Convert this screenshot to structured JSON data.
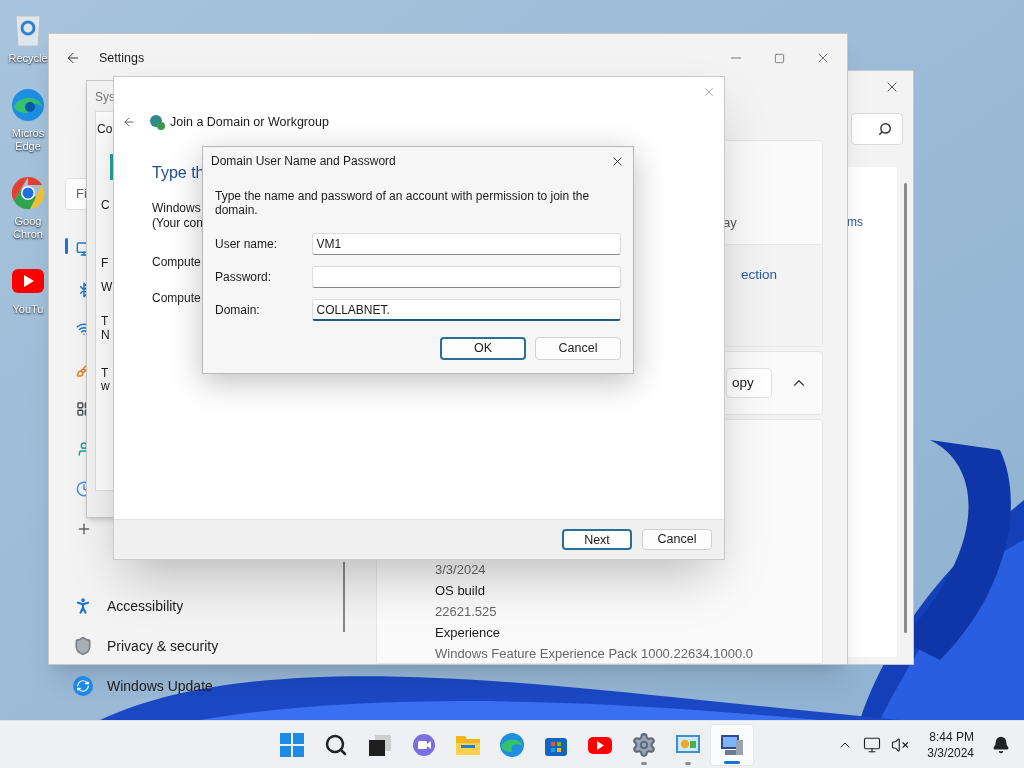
{
  "desktop": {
    "icons": [
      {
        "kind": "recycle",
        "label_lines": [
          "Recycle"
        ]
      },
      {
        "kind": "edge",
        "label_lines": [
          "Micros",
          "Edge"
        ]
      },
      {
        "kind": "chrome",
        "label_lines": [
          "Goog",
          "Chron"
        ]
      },
      {
        "kind": "youtube",
        "label_lines": [
          "YouTu"
        ]
      }
    ]
  },
  "back_window": {
    "link": "ms"
  },
  "settings": {
    "title": "Settings",
    "search": {
      "placeholder": "Fi"
    },
    "sidebar": {
      "items": [
        {
          "kind": "accessibility",
          "label": "Accessibility"
        },
        {
          "kind": "privacy",
          "label": "Privacy & security"
        },
        {
          "kind": "update",
          "label": "Windows Update"
        }
      ]
    },
    "cards": {
      "text": "ay",
      "link": "ection",
      "button": "opy"
    },
    "specs": [
      {
        "kind": "value",
        "text": "3/3/2024"
      },
      {
        "kind": "heading",
        "text": "OS build"
      },
      {
        "kind": "value",
        "text": "22621.525"
      },
      {
        "kind": "heading",
        "text": "Experience"
      },
      {
        "kind": "value",
        "text": "Windows Feature Experience Pack 1000.22634.1000.0"
      }
    ]
  },
  "system_window": {
    "title": "Sys",
    "tab": "Co",
    "fragments": [
      "C",
      "F",
      "W",
      "T",
      "N",
      "T",
      "w"
    ]
  },
  "join_window": {
    "title": "Join a Domain or Workgroup",
    "heading": "Type th",
    "lines": [
      "Windows",
      "(Your con"
    ],
    "labels": [
      "Compute",
      "Compute"
    ],
    "buttons": [
      {
        "label": "Next",
        "default": true
      },
      {
        "label": "Cancel",
        "default": false
      }
    ]
  },
  "dialog": {
    "title": "Domain User Name and Password",
    "text": "Type the name and password of an account with permission to join the domain.",
    "fields": [
      {
        "label": "User name:",
        "value": "VM1",
        "focused": false
      },
      {
        "label": "Password:",
        "focused": false
      },
      {
        "label": "Domain:",
        "value": "COLLABNET.",
        "focused": true
      }
    ],
    "buttons": [
      {
        "label": "OK",
        "default": true
      },
      {
        "label": "Cancel",
        "default": false
      }
    ]
  },
  "taskbar": {
    "apps": [
      {
        "kind": "start",
        "selected": false,
        "running": false
      },
      {
        "kind": "search",
        "selected": false,
        "running": false
      },
      {
        "kind": "taskview",
        "selected": false,
        "running": false
      },
      {
        "kind": "chat",
        "selected": false,
        "running": false
      },
      {
        "kind": "folder",
        "selected": false,
        "running": false
      },
      {
        "kind": "edge",
        "selected": false,
        "running": false
      },
      {
        "kind": "store",
        "selected": false,
        "running": false
      },
      {
        "kind": "youtube",
        "selected": false,
        "running": false
      },
      {
        "kind": "settings",
        "selected": false,
        "running": true
      },
      {
        "kind": "panel",
        "selected": false,
        "running": true
      },
      {
        "kind": "computer",
        "selected": true,
        "running": true
      }
    ],
    "time": "8:44 PM",
    "date": "3/3/2024"
  }
}
